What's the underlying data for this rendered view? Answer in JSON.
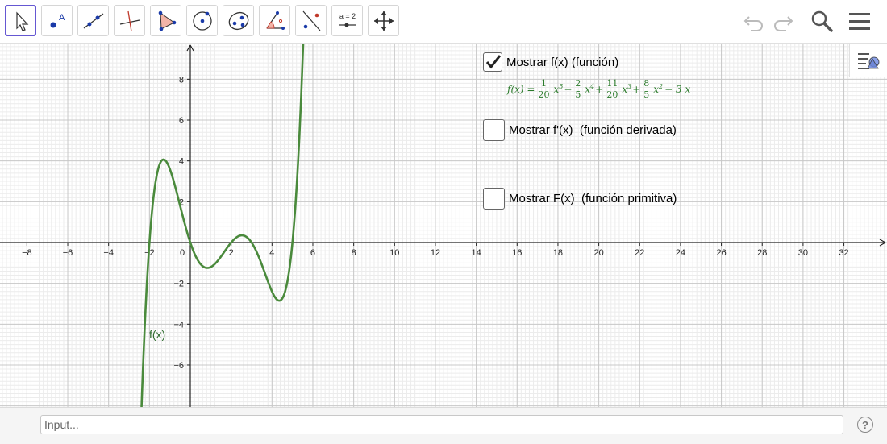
{
  "toolbar": {
    "tools": [
      {
        "name": "move-tool",
        "icon": "arrow-cursor-icon",
        "label": ""
      },
      {
        "name": "point-tool",
        "icon": "point-icon",
        "label": "A"
      },
      {
        "name": "line-tool",
        "icon": "line-icon",
        "label": ""
      },
      {
        "name": "perpendicular-tool",
        "icon": "perpendicular-line-icon",
        "label": ""
      },
      {
        "name": "polygon-tool",
        "icon": "polygon-icon",
        "label": ""
      },
      {
        "name": "circle-tool",
        "icon": "circle-center-point-icon",
        "label": ""
      },
      {
        "name": "ellipse-tool",
        "icon": "ellipse-icon",
        "label": ""
      },
      {
        "name": "angle-tool",
        "icon": "angle-icon",
        "label": "α"
      },
      {
        "name": "reflect-tool",
        "icon": "reflect-about-line-icon",
        "label": ""
      },
      {
        "name": "slider-tool",
        "icon": "slider-icon",
        "label": "a = 2"
      },
      {
        "name": "move-graphics-tool",
        "icon": "move-arrows-icon",
        "label": ""
      }
    ],
    "right_icons": [
      "undo-icon",
      "redo-icon",
      "search-icon",
      "menu-icon"
    ]
  },
  "graphics": {
    "x_ticks": [
      "−8",
      "−6",
      "−4",
      "−2",
      "0",
      "2",
      "4",
      "6",
      "8",
      "10",
      "12",
      "14",
      "16",
      "18",
      "20",
      "22",
      "24",
      "26",
      "28",
      "30",
      "32"
    ],
    "y_ticks": [
      "8",
      "6",
      "4",
      "2",
      "−2",
      "−4",
      "−6"
    ],
    "function_label": "f(x)",
    "function_color": "#4a8a3c"
  },
  "checkboxes": [
    {
      "label": "Mostrar f(x) (función)",
      "checked": true
    },
    {
      "label": "Mostrar f'(x)  (función derivada)",
      "checked": false
    },
    {
      "label": "Mostrar F(x)  (función primitiva)",
      "checked": false
    }
  ],
  "formula": {
    "lhs": "f(x) =",
    "terms": [
      {
        "num": "1",
        "den": "20",
        "power": "x",
        "exp": "5",
        "sign": ""
      },
      {
        "num": "2",
        "den": "5",
        "power": "x",
        "exp": "4",
        "sign": "−"
      },
      {
        "num": "11",
        "den": "20",
        "power": "x",
        "exp": "3",
        "sign": "+"
      },
      {
        "num": "8",
        "den": "5",
        "power": "x",
        "exp": "2",
        "sign": "+"
      }
    ],
    "tail": "− 3 x"
  },
  "inputbar": {
    "placeholder": "Input..."
  }
}
